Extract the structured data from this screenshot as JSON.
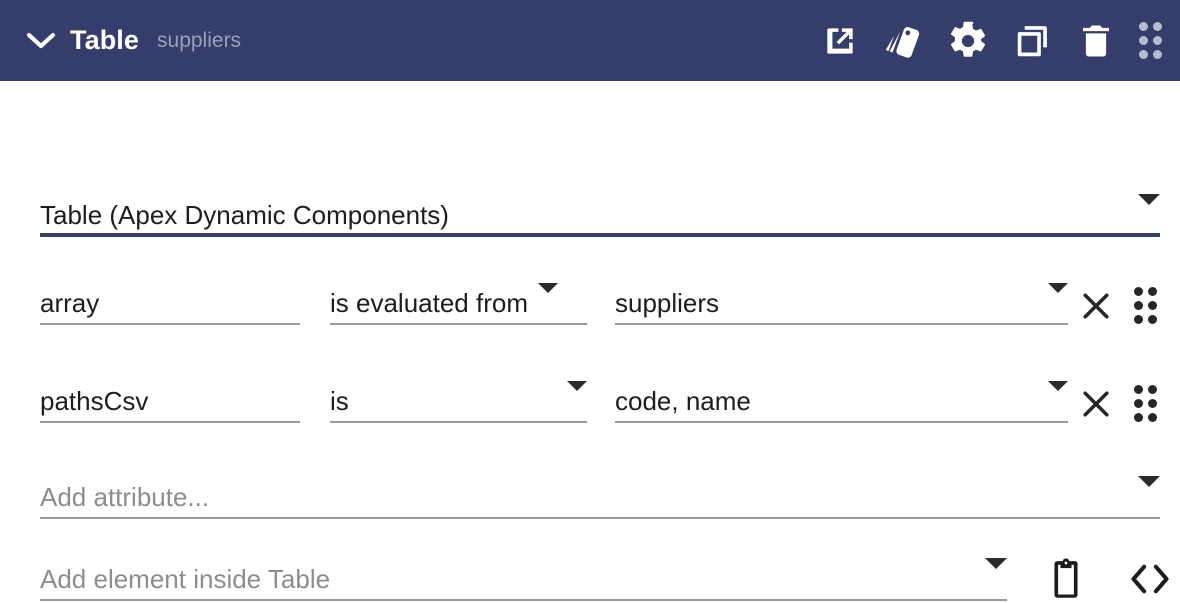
{
  "header": {
    "collapse_icon": "chevron-down-icon",
    "title": "Table",
    "subtitle": "suppliers",
    "tools": [
      {
        "name": "open-in-new-icon",
        "label": "Open in new window"
      },
      {
        "name": "style-palette-icon",
        "label": "Style"
      },
      {
        "name": "gear-icon",
        "label": "Settings"
      },
      {
        "name": "copy-icon",
        "label": "Duplicate"
      },
      {
        "name": "trash-icon",
        "label": "Delete"
      },
      {
        "name": "drag-handle-icon",
        "label": "Drag to reorder"
      }
    ],
    "background_color": "#353d6b",
    "title_color": "#ffffff",
    "subtitle_color": "#9a9fb8"
  },
  "type_select": {
    "value": "Table (Apex Dynamic Components)",
    "caret_icon": "chevron-down-icon",
    "underline_color": "#353d6b"
  },
  "attributes": [
    {
      "name": "array",
      "operator": "is evaluated from",
      "value": "suppliers",
      "name_caret": "",
      "operator_caret_icon": "chevron-down-icon",
      "value_caret_icon": "chevron-down-icon",
      "clear_icon": "close-icon",
      "drag_icon": "drag-handle-icon"
    },
    {
      "name": "pathsCsv",
      "operator": "is",
      "value": "code, name",
      "name_caret": "",
      "operator_caret_icon": "chevron-down-icon",
      "value_caret_icon": "chevron-down-icon",
      "clear_icon": "close-icon",
      "drag_icon": "drag-handle-icon"
    }
  ],
  "add_attribute": {
    "placeholder": "Add attribute...",
    "caret_icon": "chevron-down-icon"
  },
  "add_element": {
    "placeholder": "Add element inside Table",
    "caret_icon": "chevron-down-icon"
  },
  "bottom_actions": [
    {
      "name": "clipboard-paste-icon",
      "label": "Paste"
    },
    {
      "name": "code-view-icon",
      "label": "View code"
    }
  ],
  "colors": {
    "accent": "#353d6b",
    "rule": "#9b9b9b",
    "text": "#1d1d1d",
    "placeholder": "#8d8d8d"
  }
}
